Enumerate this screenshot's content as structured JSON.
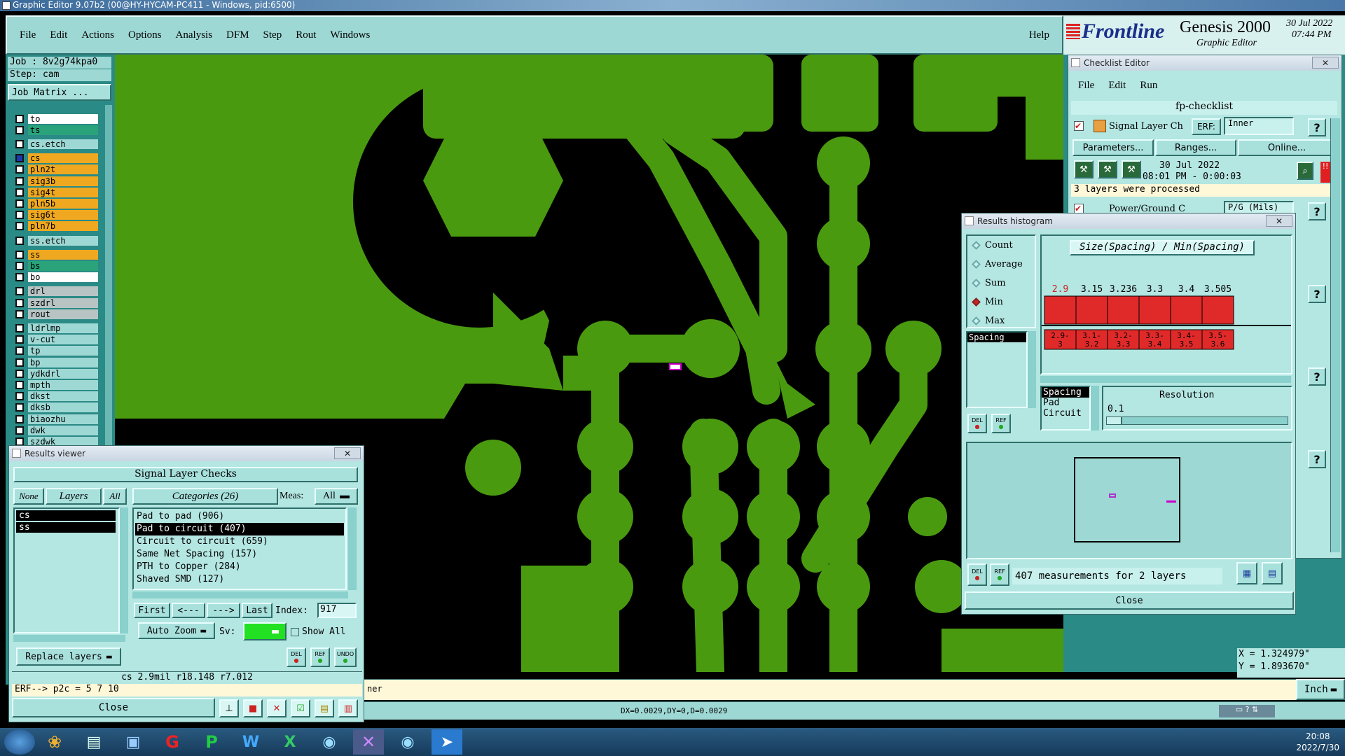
{
  "window": {
    "title": "Graphic Editor 9.07b2 (00@HY-HYCAM-PC411 - Windows, pid:6500)"
  },
  "menubar": {
    "items": [
      "File",
      "Edit",
      "Actions",
      "Options",
      "Analysis",
      "DFM",
      "Step",
      "Rout",
      "Windows"
    ],
    "help": "Help"
  },
  "brand": {
    "logo": "Frontline",
    "product": "Genesis 2000",
    "subtitle": "Graphic Editor",
    "date": "30 Jul 2022",
    "time": "07:44 PM"
  },
  "left_panel": {
    "job": "Job : 8v2g74kpa0",
    "step": "Step: cam",
    "job_matrix": "Job Matrix ...",
    "layers": [
      {
        "name": "to",
        "color": "#ffffff"
      },
      {
        "name": "ts",
        "color": "#2aa37a"
      },
      {
        "name": "cs.etch",
        "color": "#9ed8d4"
      },
      {
        "name": "cs",
        "color": "#f0a820"
      },
      {
        "name": "pln2t",
        "color": "#f0a820"
      },
      {
        "name": "sig3b",
        "color": "#f0a820"
      },
      {
        "name": "sig4t",
        "color": "#f0a820"
      },
      {
        "name": "pln5b",
        "color": "#f0a820"
      },
      {
        "name": "sig6t",
        "color": "#f0a820"
      },
      {
        "name": "pln7b",
        "color": "#f0a820"
      },
      {
        "name": "ss.etch",
        "color": "#9ed8d4"
      },
      {
        "name": "ss",
        "color": "#f0a820"
      },
      {
        "name": "bs",
        "color": "#2aa37a"
      },
      {
        "name": "bo",
        "color": "#ffffff"
      },
      {
        "name": "drl",
        "color": "#b8c4c4"
      },
      {
        "name": "szdrl",
        "color": "#b8c4c4"
      },
      {
        "name": "rout",
        "color": "#b8c4c4"
      },
      {
        "name": "ldrlmp",
        "color": "#9ed8d4"
      },
      {
        "name": "v-cut",
        "color": "#9ed8d4"
      },
      {
        "name": "tp",
        "color": "#9ed8d4"
      },
      {
        "name": "bp",
        "color": "#9ed8d4"
      },
      {
        "name": "ydkdrl",
        "color": "#9ed8d4"
      },
      {
        "name": "mpth",
        "color": "#9ed8d4"
      },
      {
        "name": "dkst",
        "color": "#9ed8d4"
      },
      {
        "name": "dksb",
        "color": "#9ed8d4"
      },
      {
        "name": "biaozhu",
        "color": "#9ed8d4"
      },
      {
        "name": "dwk",
        "color": "#9ed8d4"
      },
      {
        "name": "szdwk",
        "color": "#9ed8d4"
      }
    ]
  },
  "checklist": {
    "title": "Checklist Editor",
    "menu": [
      "File",
      "Edit",
      "Run"
    ],
    "name": "fp-checklist",
    "action1": "Signal Layer Ch",
    "erf_label": "ERF:",
    "erf_value": "Inner",
    "params": "Parameters...",
    "ranges": "Ranges...",
    "online": "Online...",
    "run_date": "30 Jul 2022",
    "run_time": "08:01 PM - 0:00:03",
    "status": "3 layers were processed",
    "action2": "Power/Ground C",
    "erf2_value": "P/G (Mils)"
  },
  "histogram": {
    "title": "Results histogram",
    "modes": [
      "Count",
      "Average",
      "Sum",
      "Min",
      "Max"
    ],
    "selected_mode": "Min",
    "header": "Size(Spacing) / Min(Spacing)",
    "list": [
      "Spacing"
    ],
    "list2": [
      "Spacing",
      "Pad",
      "Circuit"
    ],
    "resolution_label": "Resolution",
    "resolution_value": "0.1",
    "summary": "407 measurements for 2 layers",
    "close": "Close",
    "del": "DEL",
    "ref": "REF"
  },
  "chart_data": {
    "type": "bar",
    "categories": [
      "2.9-3",
      "3.1-3.2",
      "3.2-3.3",
      "3.3-3.4",
      "3.4-3.5",
      "3.5-3.6"
    ],
    "values": [
      2.9,
      3.15,
      3.236,
      3.3,
      3.4,
      3.505
    ],
    "title": "Size(Spacing) / Min(Spacing)",
    "highlight_color": "#e02a2a"
  },
  "results": {
    "title": "Results viewer",
    "header": "Signal Layer Checks",
    "none": "None",
    "layers": "Layers",
    "all": "All",
    "categories_label": "Categories (26)",
    "meas_label": "Meas:",
    "meas_value": "All",
    "layer_list": [
      "cs",
      "ss"
    ],
    "categories": [
      "Pad to pad (906)",
      "Pad to circuit (407)",
      "Circuit to circuit (659)",
      "Same Net Spacing (157)",
      "PTH to Copper (284)",
      "Shaved SMD (127)"
    ],
    "first": "First",
    "prev": "<---",
    "next": "--->",
    "last": "Last",
    "index_label": "Index:",
    "index_value": "917",
    "auto_zoom": "Auto Zoom",
    "sv": "Sv:",
    "show_all": "Show All",
    "replace": "Replace layers",
    "del": "DEL",
    "ref": "REF",
    "undo": "UNDO",
    "info": "cs 2.9mil  r18.148  r7.012",
    "erf": "ERF--> p2c = 5 7 10",
    "close": "Close"
  },
  "statusbar": {
    "coord_x": "X = 1.324979\"",
    "coord_y": "Y = 1.893670\"",
    "dxdy": "DX=0.0029,DY=0,D=0.0029",
    "unit": "Inch",
    "msg": "ner"
  },
  "taskbar": {
    "time": "20:08",
    "date": "2022/7/30"
  }
}
